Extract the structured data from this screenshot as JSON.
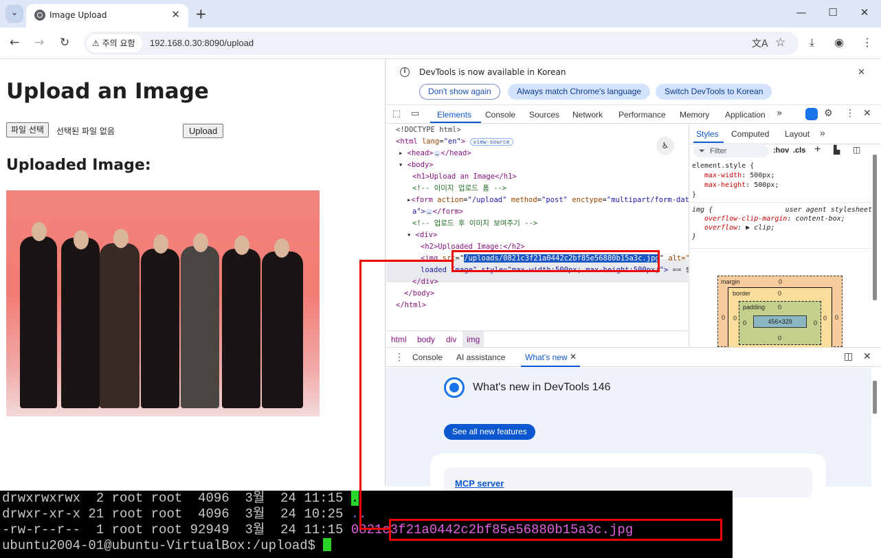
{
  "browser": {
    "tab_title": "Image Upload",
    "new_tab_label": "+",
    "chevron": "⌄",
    "security_chip": "주의 요함",
    "url": "192.168.0.30:8090/upload"
  },
  "page": {
    "heading": "Upload an Image",
    "file_button": "파일 선택",
    "file_status": "선택된 파일 없음",
    "upload_button": "Upload",
    "subheading": "Uploaded Image:"
  },
  "devtools": {
    "info_text": "DevTools is now available in Korean",
    "btn_dont_show": "Don't show again",
    "btn_always_match": "Always match Chrome's language",
    "btn_switch": "Switch DevTools to Korean",
    "tabs": [
      "Elements",
      "Console",
      "Sources",
      "Network",
      "Performance",
      "Memory",
      "Application"
    ],
    "code": {
      "doctype": "<!DOCTYPE html>",
      "html_open": "<html",
      "html_attr": "lang",
      "html_val": "\"en\"",
      "view_source": "view-source",
      "head": "<head>",
      "head_close": "</head>",
      "body": "<body>",
      "h1": "<h1>Upload an Image</h1>",
      "comment1": "<!-- 이미지 업로드 폼 -->",
      "form_open": "<form",
      "form_action_attr": "action",
      "form_action_val": "\"/upload\"",
      "form_method_attr": "method",
      "form_method_val": "\"post\"",
      "form_enctype_attr": "enctype",
      "form_enctype_val": "\"multipart/form-dat",
      "form_enctype_val2": "a\">",
      "form_close": "</form>",
      "comment2": "<!-- 업로드 후 이미지 보여주기 -->",
      "div": "<div>",
      "h2": "<h2>Uploaded Image:</h2>",
      "img_tag": "<img",
      "img_src_attr": "src",
      "img_src_val": "/uploads/0821c3f21a0442c2bf85e56880b15a3c.jpg",
      "img_alt": "alt=\"Up",
      "img_line2": "loaded Image\" style=\"max-width:500px; max-height:500px;\">",
      "dollar0": "== $0",
      "div_close": "</div>",
      "body_close": "</body>",
      "html_close": "</html>"
    },
    "breadcrumbs": [
      "html",
      "body",
      "div",
      "img"
    ],
    "styles": {
      "tabs": [
        "Styles",
        "Computed",
        "Layout"
      ],
      "filter_placeholder": "Filter",
      "hov": ":hov",
      "cls": ".cls",
      "rule1_selector": "element.style {",
      "rule1_prop1": "max-width",
      "rule1_val1": "500px;",
      "rule1_prop2": "max-height",
      "rule1_val2": "500px;",
      "brace_close": "}",
      "rule2_selector": "img {",
      "rule2_source": "user agent stylesheet",
      "rule2_prop1": "overflow-clip-margin",
      "rule2_val1": "content-box;",
      "rule2_prop2": "overflow",
      "rule2_val2": "clip;",
      "box_margin": "margin",
      "box_border": "border",
      "box_padding": "padding",
      "box_content": "456×329",
      "zero": "0"
    },
    "drawer": {
      "tabs": [
        "Console",
        "AI assistance",
        "What's new"
      ],
      "whatsnew_title": "What's new in DevTools 146",
      "see_all": "See all new features",
      "card_link": "MCP server"
    }
  },
  "terminal": {
    "lines": [
      {
        "perm": "drwxrwxrwx",
        "links": "2",
        "owner": "root",
        "group": "root",
        "size": "4096",
        "month": "3월",
        "day": "24",
        "time": "11:15",
        "name": "."
      },
      {
        "perm": "drwxr-xr-x",
        "links": "21",
        "owner": "root",
        "group": "root",
        "size": "4096",
        "month": "3월",
        "day": "24",
        "time": "10:25",
        "name": ".."
      },
      {
        "perm": "-rw-r--r--",
        "links": "1",
        "owner": "root",
        "group": "root",
        "size": "92949",
        "month": "3월",
        "day": "24",
        "time": "11:15",
        "name": "0821c3f21a0442c2bf85e56880b15a3c.jpg"
      }
    ],
    "line0": "drwxrwxrwx  2 root root  4096  3월  24 11:15 ",
    "line0_name": ".",
    "line1": "drwxr-xr-x 21 root root  4096  3월  24 10:25 ",
    "line1_name": "..",
    "line2": "-rw-r--r--  1 root root 92949  3월  24 11:15 ",
    "line2_name": "0821c3f21a0442c2bf85e56880b15a3c.jpg",
    "prompt": "ubuntu2004-01@ubuntu-VirtualBox:/upload$ "
  },
  "colors": {
    "accent": "#0b57d0",
    "annotation": "#e00000",
    "terminal_bg": "#000000",
    "terminal_filename": "#e060e0"
  }
}
